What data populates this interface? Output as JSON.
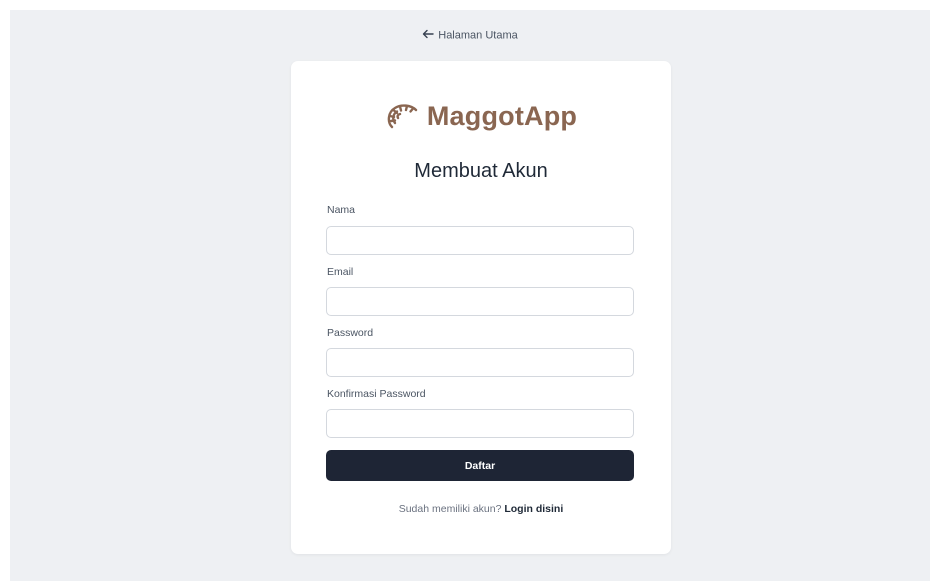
{
  "nav": {
    "back_label": "Halaman Utama",
    "back_icon": "arrow-left-icon"
  },
  "brand": {
    "name": "MaggotApp",
    "logo_icon": "maggot-logo-icon",
    "color": "#8a6651"
  },
  "form": {
    "heading": "Membuat Akun",
    "fields": [
      {
        "label": "Nama",
        "value": "",
        "placeholder": ""
      },
      {
        "label": "Email",
        "value": "",
        "placeholder": ""
      },
      {
        "label": "Password",
        "value": "",
        "placeholder": ""
      },
      {
        "label": "Konfirmasi Password",
        "value": "",
        "placeholder": ""
      }
    ],
    "submit_label": "Daftar",
    "submit_color": "#1e2535"
  },
  "footer": {
    "prompt": "Sudah memiliki akun?",
    "login_link": "Login disini"
  },
  "colors": {
    "page_background": "#eef0f3",
    "card_background": "#ffffff"
  }
}
